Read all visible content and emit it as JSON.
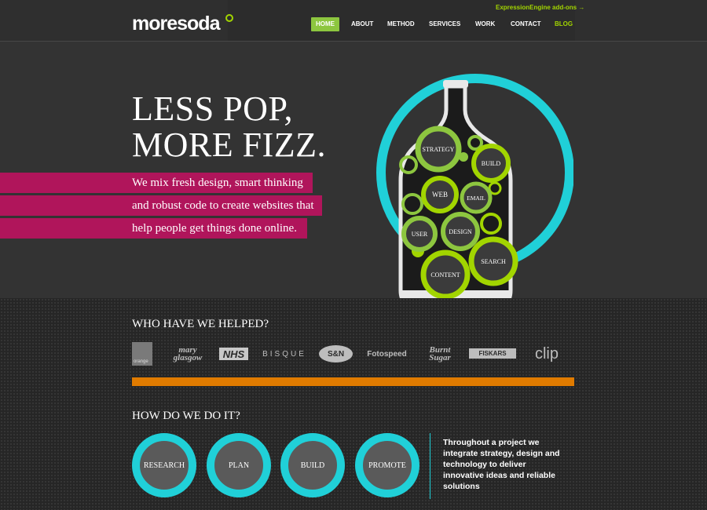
{
  "header": {
    "logo": "moresoda",
    "addons_link": "ExpressionEngine add-ons →",
    "nav": [
      {
        "label": "HOME",
        "active": true
      },
      {
        "label": "ABOUT"
      },
      {
        "label": "METHOD"
      },
      {
        "label": "SERVICES"
      },
      {
        "label": "WORK"
      },
      {
        "label": "CONTACT"
      },
      {
        "label": "BLOG",
        "accent": true
      }
    ]
  },
  "hero": {
    "headline_line1": "LESS POP,",
    "headline_line2": "MORE FIZZ.",
    "tagline_lines": [
      "We mix fresh design, smart thinking",
      "and robust code to create websites that",
      "help people get things done online."
    ],
    "bottle_bubbles": [
      "STRATEGY",
      "BUILD",
      "WEB",
      "EMAIL",
      "USER",
      "DESIGN",
      "SEARCH",
      "CONTENT"
    ]
  },
  "clients": {
    "title": "WHO HAVE WE HELPED?",
    "logos": [
      "orange",
      "mary glasgow",
      "NHS",
      "BISQUE",
      "S&N",
      "Fotospeed",
      "Burnt Sugar",
      "FISKARS",
      "clip"
    ]
  },
  "method": {
    "title": "HOW DO WE DO IT?",
    "steps": [
      "RESEARCH",
      "PLAN",
      "BUILD",
      "PROMOTE"
    ],
    "blurb": "Throughout a project we integrate strategy, design and technology to deliver innovative ideas and reliable solutions"
  },
  "colors": {
    "accent_green": "#a2d500",
    "magenta": "#b0155b",
    "cyan": "#20d0d8",
    "orange": "#e07b00",
    "bg_dark": "#333333"
  }
}
